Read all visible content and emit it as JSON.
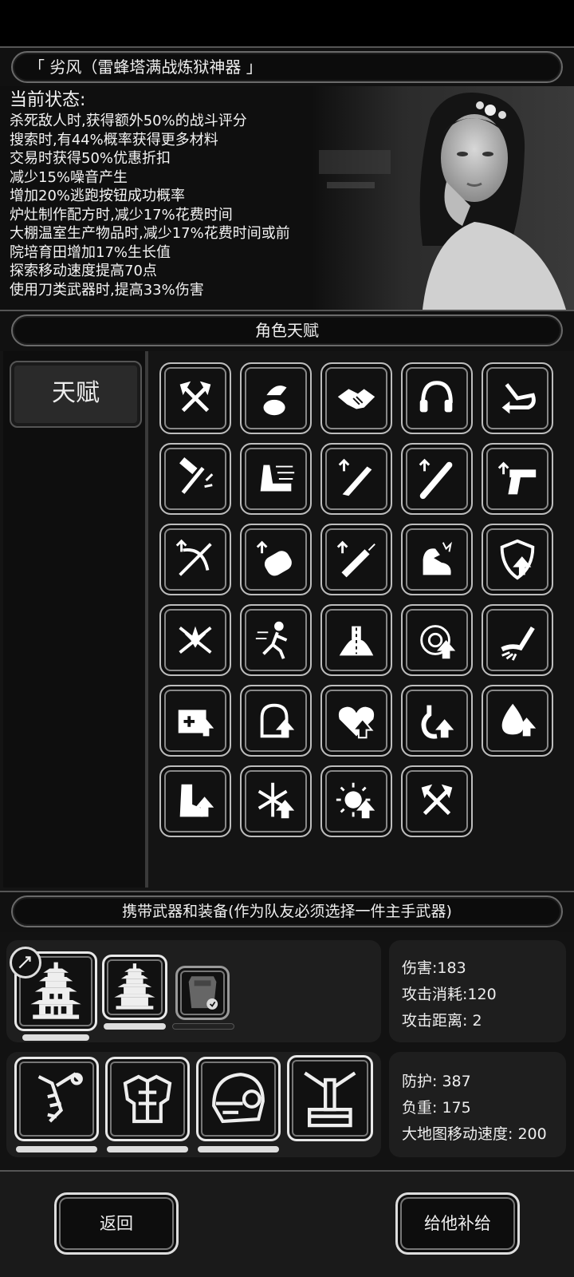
{
  "header": {
    "title": "「 劣风（雷蜂塔满战炼狱神器 」"
  },
  "status": {
    "title": "当前状态:",
    "lines": [
      "杀死敌人时,获得额外50%的战斗评分",
      "搜索时,有44%概率获得更多材料",
      "交易时获得50%优惠折扣",
      "减少15%噪音产生",
      "增加20%逃跑按钮成功概率",
      "炉灶制作配方时,减少17%花费时间",
      "大棚温室生产物品时,减少17%花费时间或前",
      "院培育田增加17%生长值",
      "探索移动速度提高70点",
      "使用刀类武器时,提高33%伤害"
    ]
  },
  "talents": {
    "header": "角色天赋",
    "tab": "天赋",
    "icons": [
      "crossed-axes-icon",
      "sack-icon",
      "handshake-icon",
      "headphones-icon",
      "return-arrow-icon",
      "hammer-axe-icon",
      "speed-boot-icon",
      "machete-up-icon",
      "bat-up-icon",
      "pistol-up-icon",
      "crossbow-up-icon",
      "fist-up-icon",
      "syringe-up-icon",
      "flexed-arm-icon",
      "shield-up-icon",
      "crossed-swords-burst-icon",
      "running-man-icon",
      "road-icon",
      "target-up-icon",
      "claw-arm-icon",
      "medkit-up-icon",
      "bag-up-icon",
      "heart-up-icon",
      "stomach-up-icon",
      "drop-up-icon",
      "boot-up-icon",
      "snowflake-up-icon",
      "sun-up-icon",
      "crossed-axes-icon"
    ]
  },
  "equipment": {
    "header": "携带武器和装备(作为队友必须选择一件主手武器)",
    "weapon_stats": [
      "伤害:183",
      "攻击消耗:120",
      "攻击距离: 2"
    ],
    "armor_stats": [
      "防护: 387",
      "负重: 175",
      "大地图移动速度: 200"
    ],
    "weapon_slots": [
      "pagoda-weapon-icon",
      "pagoda-weapon-small-icon",
      "riot-shield-icon"
    ],
    "armor_slots": [
      "arm-armor-icon",
      "chest-armor-icon",
      "helmet-icon",
      "leg-armor-icon"
    ]
  },
  "actions": {
    "back": "返回",
    "supply": "给他补给"
  }
}
